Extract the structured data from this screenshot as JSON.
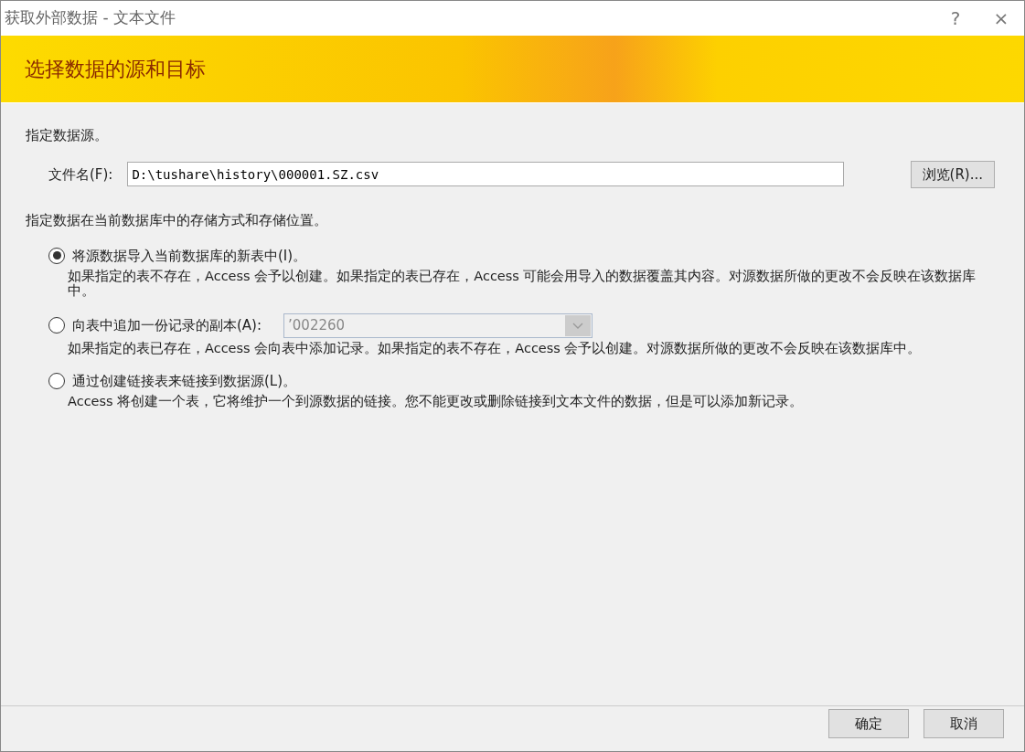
{
  "window": {
    "title": "获取外部数据 - 文本文件",
    "help": "?",
    "close": "×"
  },
  "banner": {
    "title": "选择数据的源和目标"
  },
  "source": {
    "heading": "指定数据源。",
    "file_label": "文件名(F):",
    "file_value": "D:\\tushare\\history\\000001.SZ.csv",
    "browse": "浏览(R)..."
  },
  "storage_heading": "指定数据在当前数据库中的存储方式和存储位置。",
  "options": [
    {
      "label": "将源数据导入当前数据库的新表中(I)。",
      "selected": true,
      "description": "如果指定的表不存在，Access 会予以创建。如果指定的表已存在，Access 可能会用导入的数据覆盖其内容。对源数据所做的更改不会反映在该数据库中。"
    },
    {
      "label": "向表中追加一份记录的副本(A):",
      "selected": false,
      "combo": {
        "value": "’002260",
        "disabled": true
      },
      "description": "如果指定的表已存在，Access 会向表中添加记录。如果指定的表不存在，Access 会予以创建。对源数据所做的更改不会反映在该数据库中。"
    },
    {
      "label": "通过创建链接表来链接到数据源(L)。",
      "selected": false,
      "description": "Access 将创建一个表，它将维护一个到源数据的链接。您不能更改或删除链接到文本文件的数据，但是可以添加新记录。"
    }
  ],
  "buttons": [
    "确定",
    "取消"
  ]
}
